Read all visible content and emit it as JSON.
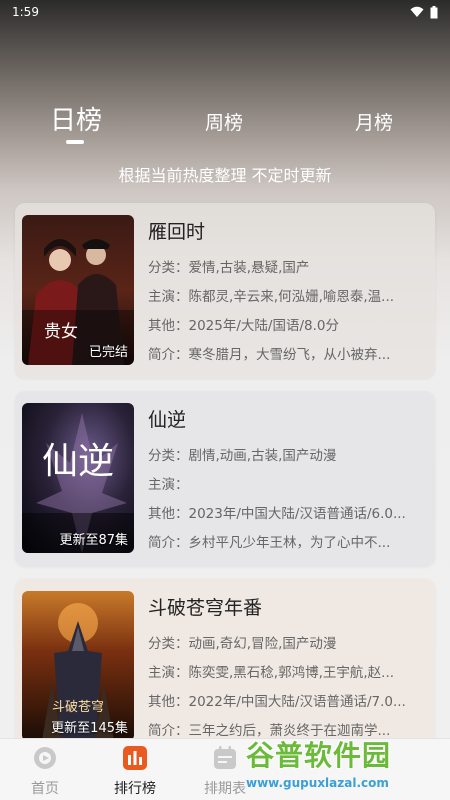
{
  "status": {
    "time": "1:59"
  },
  "tabs": [
    {
      "label": "日榜",
      "active": true
    },
    {
      "label": "周榜",
      "active": false
    },
    {
      "label": "月榜",
      "active": false
    }
  ],
  "subtitle": "根据当前热度整理 不定时更新",
  "labels": {
    "category": "分类：",
    "cast": "主演：",
    "other": "其他：",
    "intro": "简介："
  },
  "items": [
    {
      "title": "雁回时",
      "category": "爱情,古装,悬疑,国产",
      "cast": "陈都灵,辛云来,何泓姗,喻恩泰,温...",
      "other": "2025年/大陆/国语/8.0分",
      "intro": "寒冬腊月，大雪纷飞，从小被弃...",
      "badge": "已完结",
      "poster_text": "贵女"
    },
    {
      "title": "仙逆",
      "category": "剧情,动画,古装,国产动漫",
      "cast": "",
      "other": "2023年/中国大陆/汉语普通话/6.0...",
      "intro": "乡村平凡少年王林，为了心中不...",
      "badge": "更新至87集",
      "poster_text": "仙逆"
    },
    {
      "title": "斗破苍穹年番",
      "category": "动画,奇幻,冒险,国产动漫",
      "cast": "陈奕雯,黑石稔,郭鸿博,王宇航,赵...",
      "other": "2022年/中国大陆/汉语普通话/7.0...",
      "intro": "三年之约后，萧炎终于在迦南学...",
      "badge": "更新至145集",
      "poster_text": "斗破苍穹"
    }
  ],
  "nav": [
    {
      "label": "首页",
      "icon": "home-icon"
    },
    {
      "label": "排行榜",
      "icon": "ranking-icon"
    },
    {
      "label": "排期表",
      "icon": "calendar-icon"
    }
  ],
  "watermark": {
    "name": "谷普软件园",
    "url": "www.gupuxlazal.com"
  },
  "colors": {
    "accent": "#e85a1f",
    "watermark_green": "#6cba3a",
    "watermark_blue": "#3aa0d8"
  }
}
